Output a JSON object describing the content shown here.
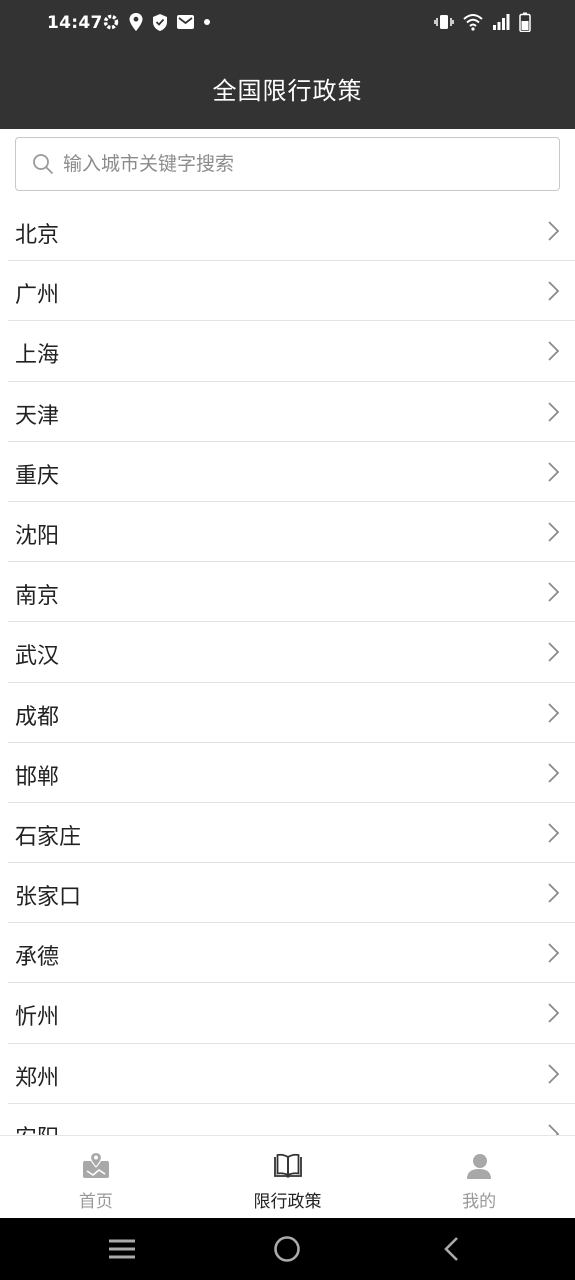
{
  "status_bar": {
    "time": "14:47",
    "left_icons": [
      "gear-icon",
      "location-icon",
      "shield-icon",
      "mail-icon",
      "dot-icon"
    ],
    "right_icons": [
      "vibrate-icon",
      "wifi-icon",
      "signal-icon",
      "battery-icon"
    ]
  },
  "header": {
    "title": "全国限行政策"
  },
  "search": {
    "placeholder": "输入城市关键字搜索",
    "value": ""
  },
  "cities": [
    "北京",
    "广州",
    "上海",
    "天津",
    "重庆",
    "沈阳",
    "南京",
    "武汉",
    "成都",
    "邯郸",
    "石家庄",
    "张家口",
    "承德",
    "忻州",
    "郑州",
    "安阳"
  ],
  "bottom_nav": {
    "items": [
      {
        "label": "首页",
        "icon": "map-icon",
        "active": false
      },
      {
        "label": "限行政策",
        "icon": "book-icon",
        "active": true
      },
      {
        "label": "我的",
        "icon": "user-icon",
        "active": false
      }
    ]
  },
  "system_nav": [
    "menu-icon",
    "home-circle-icon",
    "back-icon"
  ],
  "colors": {
    "header_bg": "#333333",
    "active_label": "#222222",
    "inactive_label": "#999999"
  }
}
